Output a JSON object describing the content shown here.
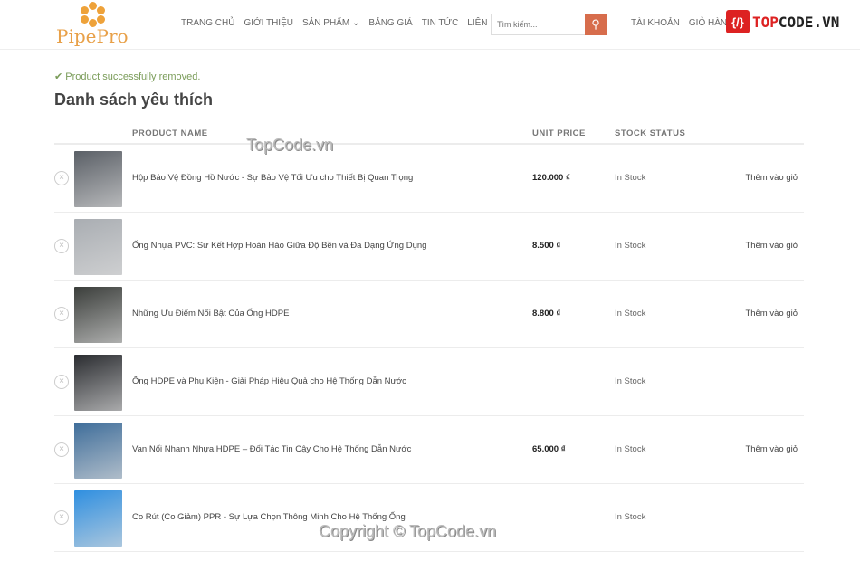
{
  "brand": {
    "name": "PipePro",
    "color": "#e8a048"
  },
  "nav": [
    "TRANG CHỦ",
    "GIỚI THIỆU",
    "SẢN PHẨM ⌄",
    "BẢNG GIÁ",
    "TIN TỨC",
    "LIÊN HỆ"
  ],
  "search": {
    "placeholder": "Tìm kiếm...",
    "button_color": "#d76d4c"
  },
  "account": {
    "account_label": "TÀI KHOẢN",
    "cart_label": "GIỎ HÀNG"
  },
  "badge": {
    "icon": "{/}",
    "text_a": "TOP",
    "text_b": "CODE.VN"
  },
  "notice": {
    "icon": "check-icon",
    "text": "Product successfully removed."
  },
  "page_title": "Danh sách yêu thích",
  "columns": {
    "name": "PRODUCT NAME",
    "price": "UNIT PRICE",
    "stock": "STOCK STATUS"
  },
  "items": [
    {
      "name": "Hộp Bảo Vệ Đồng Hồ Nước - Sự Bảo Vệ Tối Ưu cho Thiết Bị Quan Trọng",
      "price": "120.000 ₫",
      "stock": "In Stock",
      "action": "Thêm vào giỏ",
      "thumb": "#5a5f66"
    },
    {
      "name": "Ống Nhựa PVC: Sự Kết Hợp Hoàn Hảo Giữa Độ Bền và Đa Dạng Ứng Dụng",
      "price": "8.500 ₫",
      "stock": "In Stock",
      "action": "Thêm vào giỏ",
      "thumb": "#a9adb2"
    },
    {
      "name": "Những Ưu Điểm Nổi Bật Của Ống HDPE",
      "price": "8.800 ₫",
      "stock": "In Stock",
      "action": "Thêm vào giỏ",
      "thumb": "#3a3d3a"
    },
    {
      "name": "Ống HDPE và Phụ Kiện - Giải Pháp Hiệu Quả cho Hệ Thống Dẫn Nước",
      "price": "",
      "stock": "In Stock",
      "action": "",
      "thumb": "#2a2c30"
    },
    {
      "name": "Van Nối Nhanh Nhựa HDPE – Đối Tác Tin Cậy Cho Hệ Thống Dẫn Nước",
      "price": "65.000 ₫",
      "stock": "In Stock",
      "action": "Thêm vào giỏ",
      "thumb": "#3e6d9a"
    },
    {
      "name": "Co Rút (Co Giảm) PPR - Sự Lựa Chọn Thông Minh Cho Hệ Thống Ống",
      "price": "",
      "stock": "In Stock",
      "action": "",
      "thumb": "#2f8fe0"
    }
  ],
  "watermarks": [
    "TopCode.vn",
    "Copyright © TopCode.vn"
  ]
}
